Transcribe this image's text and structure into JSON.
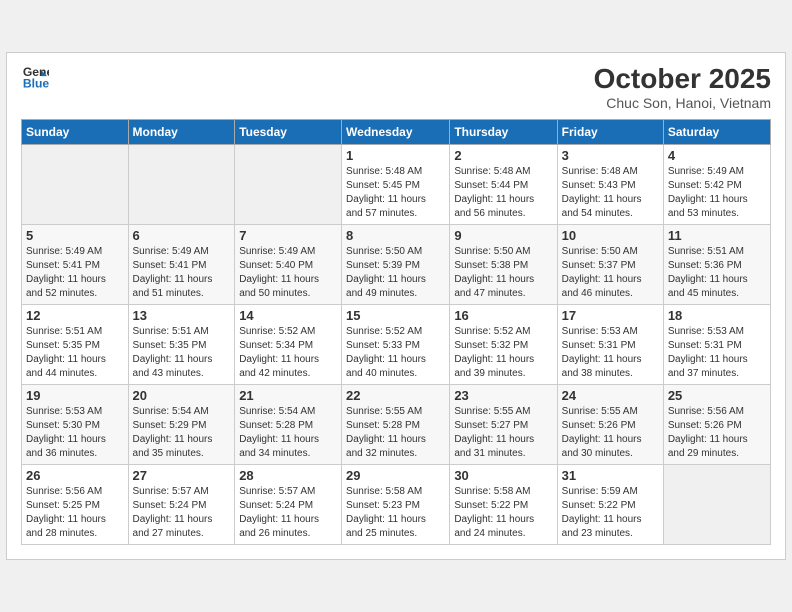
{
  "header": {
    "logo_line1": "General",
    "logo_line2": "Blue",
    "month_year": "October 2025",
    "location": "Chuc Son, Hanoi, Vietnam"
  },
  "weekdays": [
    "Sunday",
    "Monday",
    "Tuesday",
    "Wednesday",
    "Thursday",
    "Friday",
    "Saturday"
  ],
  "weeks": [
    [
      {
        "day": "",
        "info": ""
      },
      {
        "day": "",
        "info": ""
      },
      {
        "day": "",
        "info": ""
      },
      {
        "day": "1",
        "info": "Sunrise: 5:48 AM\nSunset: 5:45 PM\nDaylight: 11 hours\nand 57 minutes."
      },
      {
        "day": "2",
        "info": "Sunrise: 5:48 AM\nSunset: 5:44 PM\nDaylight: 11 hours\nand 56 minutes."
      },
      {
        "day": "3",
        "info": "Sunrise: 5:48 AM\nSunset: 5:43 PM\nDaylight: 11 hours\nand 54 minutes."
      },
      {
        "day": "4",
        "info": "Sunrise: 5:49 AM\nSunset: 5:42 PM\nDaylight: 11 hours\nand 53 minutes."
      }
    ],
    [
      {
        "day": "5",
        "info": "Sunrise: 5:49 AM\nSunset: 5:41 PM\nDaylight: 11 hours\nand 52 minutes."
      },
      {
        "day": "6",
        "info": "Sunrise: 5:49 AM\nSunset: 5:41 PM\nDaylight: 11 hours\nand 51 minutes."
      },
      {
        "day": "7",
        "info": "Sunrise: 5:49 AM\nSunset: 5:40 PM\nDaylight: 11 hours\nand 50 minutes."
      },
      {
        "day": "8",
        "info": "Sunrise: 5:50 AM\nSunset: 5:39 PM\nDaylight: 11 hours\nand 49 minutes."
      },
      {
        "day": "9",
        "info": "Sunrise: 5:50 AM\nSunset: 5:38 PM\nDaylight: 11 hours\nand 47 minutes."
      },
      {
        "day": "10",
        "info": "Sunrise: 5:50 AM\nSunset: 5:37 PM\nDaylight: 11 hours\nand 46 minutes."
      },
      {
        "day": "11",
        "info": "Sunrise: 5:51 AM\nSunset: 5:36 PM\nDaylight: 11 hours\nand 45 minutes."
      }
    ],
    [
      {
        "day": "12",
        "info": "Sunrise: 5:51 AM\nSunset: 5:35 PM\nDaylight: 11 hours\nand 44 minutes."
      },
      {
        "day": "13",
        "info": "Sunrise: 5:51 AM\nSunset: 5:35 PM\nDaylight: 11 hours\nand 43 minutes."
      },
      {
        "day": "14",
        "info": "Sunrise: 5:52 AM\nSunset: 5:34 PM\nDaylight: 11 hours\nand 42 minutes."
      },
      {
        "day": "15",
        "info": "Sunrise: 5:52 AM\nSunset: 5:33 PM\nDaylight: 11 hours\nand 40 minutes."
      },
      {
        "day": "16",
        "info": "Sunrise: 5:52 AM\nSunset: 5:32 PM\nDaylight: 11 hours\nand 39 minutes."
      },
      {
        "day": "17",
        "info": "Sunrise: 5:53 AM\nSunset: 5:31 PM\nDaylight: 11 hours\nand 38 minutes."
      },
      {
        "day": "18",
        "info": "Sunrise: 5:53 AM\nSunset: 5:31 PM\nDaylight: 11 hours\nand 37 minutes."
      }
    ],
    [
      {
        "day": "19",
        "info": "Sunrise: 5:53 AM\nSunset: 5:30 PM\nDaylight: 11 hours\nand 36 minutes."
      },
      {
        "day": "20",
        "info": "Sunrise: 5:54 AM\nSunset: 5:29 PM\nDaylight: 11 hours\nand 35 minutes."
      },
      {
        "day": "21",
        "info": "Sunrise: 5:54 AM\nSunset: 5:28 PM\nDaylight: 11 hours\nand 34 minutes."
      },
      {
        "day": "22",
        "info": "Sunrise: 5:55 AM\nSunset: 5:28 PM\nDaylight: 11 hours\nand 32 minutes."
      },
      {
        "day": "23",
        "info": "Sunrise: 5:55 AM\nSunset: 5:27 PM\nDaylight: 11 hours\nand 31 minutes."
      },
      {
        "day": "24",
        "info": "Sunrise: 5:55 AM\nSunset: 5:26 PM\nDaylight: 11 hours\nand 30 minutes."
      },
      {
        "day": "25",
        "info": "Sunrise: 5:56 AM\nSunset: 5:26 PM\nDaylight: 11 hours\nand 29 minutes."
      }
    ],
    [
      {
        "day": "26",
        "info": "Sunrise: 5:56 AM\nSunset: 5:25 PM\nDaylight: 11 hours\nand 28 minutes."
      },
      {
        "day": "27",
        "info": "Sunrise: 5:57 AM\nSunset: 5:24 PM\nDaylight: 11 hours\nand 27 minutes."
      },
      {
        "day": "28",
        "info": "Sunrise: 5:57 AM\nSunset: 5:24 PM\nDaylight: 11 hours\nand 26 minutes."
      },
      {
        "day": "29",
        "info": "Sunrise: 5:58 AM\nSunset: 5:23 PM\nDaylight: 11 hours\nand 25 minutes."
      },
      {
        "day": "30",
        "info": "Sunrise: 5:58 AM\nSunset: 5:22 PM\nDaylight: 11 hours\nand 24 minutes."
      },
      {
        "day": "31",
        "info": "Sunrise: 5:59 AM\nSunset: 5:22 PM\nDaylight: 11 hours\nand 23 minutes."
      },
      {
        "day": "",
        "info": ""
      }
    ]
  ]
}
